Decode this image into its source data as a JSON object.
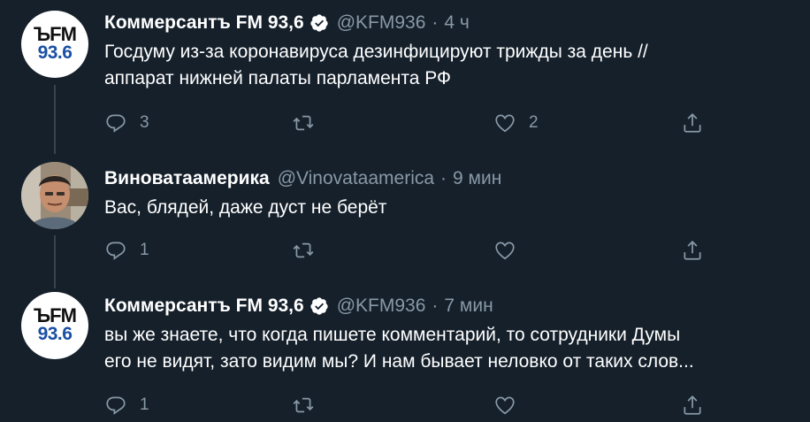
{
  "colors": {
    "background": "#15202b",
    "text": "#ffffff",
    "secondary": "#8899a6",
    "thread_line": "#38444d",
    "verified": "#ffffff",
    "kfm_blue": "#1a4fa3"
  },
  "tweets": [
    {
      "avatar": {
        "type": "logo",
        "line1": "ЪFM",
        "line2": "93.6"
      },
      "name": "Коммерсантъ FM 93,6",
      "verified": true,
      "handle": "@KFM936",
      "separator": "·",
      "time": "4 ч",
      "text_lines": [
        "Госдуму из-за коронавируса дезинфицируют трижды за день //",
        "аппарат нижней палаты парламента РФ"
      ],
      "actions": {
        "reply_count": "3",
        "retweet_count": "",
        "like_count": "2"
      }
    },
    {
      "avatar": {
        "type": "photo"
      },
      "name": "Виноватаамерика",
      "verified": false,
      "handle": "@Vinovataamerica",
      "separator": "·",
      "time": "9 мин",
      "text_lines": [
        "Вас, блядей, даже дуст не берёт"
      ],
      "actions": {
        "reply_count": "1",
        "retweet_count": "",
        "like_count": ""
      }
    },
    {
      "avatar": {
        "type": "logo",
        "line1": "ЪFM",
        "line2": "93.6"
      },
      "name": "Коммерсантъ FM 93,6",
      "verified": true,
      "handle": "@KFM936",
      "separator": "·",
      "time": "7 мин",
      "text_lines": [
        "вы же знаете, что когда пишете комментарий, то сотрудники Думы",
        "его не видят, зато видим мы? И нам бывает неловко от таких слов..."
      ],
      "actions": {
        "reply_count": "1",
        "retweet_count": "",
        "like_count": ""
      }
    }
  ],
  "icons": {
    "reply": "reply-icon",
    "retweet": "retweet-icon",
    "like": "heart-icon",
    "share": "share-icon",
    "verified": "verified-badge-icon"
  }
}
